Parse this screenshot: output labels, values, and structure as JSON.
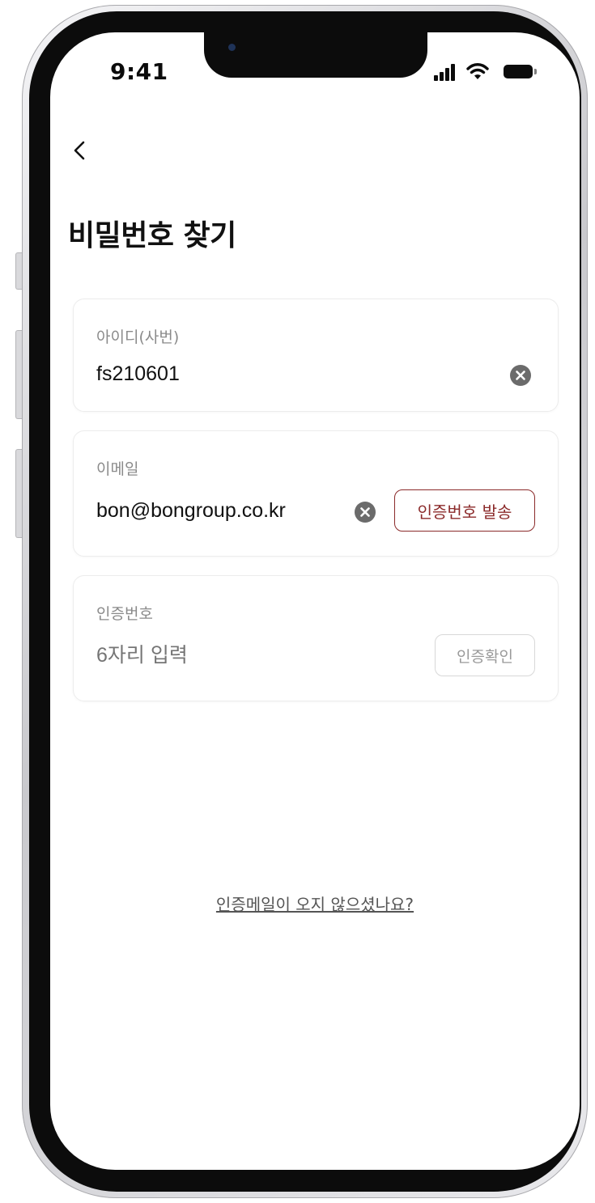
{
  "status_bar": {
    "time": "9:41"
  },
  "header": {
    "back_icon": "chevron-left-icon",
    "title": "비밀번호 찾기"
  },
  "form": {
    "id_field": {
      "label": "아이디(사번)",
      "value": "fs210601",
      "clear_icon": "clear-circle-icon"
    },
    "email_field": {
      "label": "이메일",
      "value": "bon@bongroup.co.kr",
      "clear_icon": "clear-circle-icon",
      "send_button_label": "인증번호 발송"
    },
    "code_field": {
      "label": "인증번호",
      "placeholder": "6자리 입력",
      "verify_button_label": "인증확인"
    }
  },
  "footer": {
    "link_text": "인증메일이 오지 않으셨나요?"
  },
  "colors": {
    "accent": "#8b2a2a",
    "label": "#8a8a8a",
    "text": "#111111",
    "placeholder": "#a8a8a8",
    "card_border": "#ececec",
    "disabled_border": "#d8d8d8"
  }
}
